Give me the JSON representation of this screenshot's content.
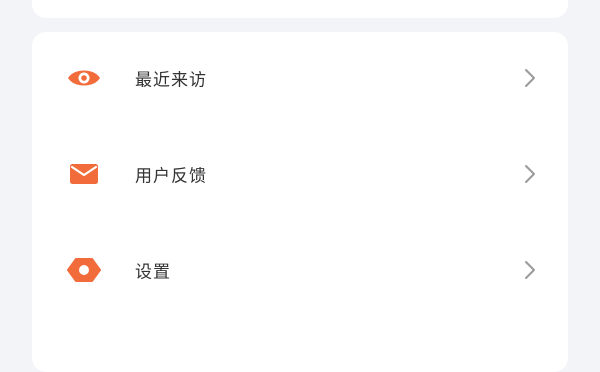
{
  "menu": {
    "items": [
      {
        "label": "最近来访",
        "icon": "eye-icon"
      },
      {
        "label": "用户反馈",
        "icon": "mail-icon"
      },
      {
        "label": "设置",
        "icon": "settings-icon"
      }
    ]
  },
  "colors": {
    "accent": "#f26b3a",
    "background": "#f2f4f7",
    "card": "#ffffff",
    "text": "#333333",
    "chevron": "#9a9a9a"
  }
}
